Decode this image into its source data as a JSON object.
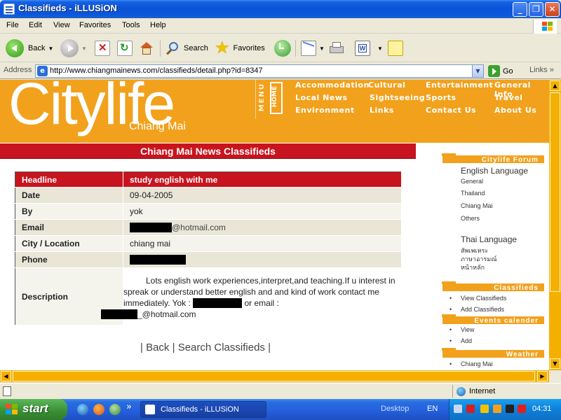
{
  "window": {
    "title": "Classifieds - iLLUSiON",
    "min": "_",
    "max": "❐",
    "close": "✕"
  },
  "menu": [
    "File",
    "Edit",
    "View",
    "Favorites",
    "Tools",
    "Help"
  ],
  "toolbar": {
    "back": "Back",
    "search": "Search",
    "favorites": "Favorites"
  },
  "address": {
    "label": "Address",
    "url": "http://www.chiangmainews.com/classifieds/detail.php?id=8347",
    "go": "Go",
    "links": "Links",
    "more": "»"
  },
  "site": {
    "logo": "Citylife",
    "sublogo": "Chiang Mai",
    "menu_vertical": "MENU",
    "home": "HOME",
    "nav": [
      {
        "label": "Accommodation"
      },
      {
        "label": "Cultural"
      },
      {
        "label": "Entertainment"
      },
      {
        "label": "General Info"
      },
      {
        "label": "Local News"
      },
      {
        "label": "Sightseeing"
      },
      {
        "label": "Travel"
      },
      {
        "label": "Environment"
      },
      {
        "label": "Links"
      },
      {
        "label": "Sports"
      },
      {
        "label": "Contact Us"
      },
      {
        "label": "About Us"
      }
    ],
    "banner": "Chiang Mai News Classifieds"
  },
  "detail": {
    "headline_label": "Headline",
    "headline_value": "study english with me",
    "date_label": "Date",
    "date_value": "09-04-2005",
    "by_label": "By",
    "by_value": "yok",
    "email_label": "Email",
    "email_domain": "@hotmail.com",
    "city_label": "City / Location",
    "city_value": "chiang mai",
    "phone_label": "Phone",
    "description_label": "Description",
    "description_line1": "Lots english work experiences,interpret,and teaching.If u interest in spreak or understand better english and and kind of work contact me immediately.  Yok : ",
    "description_line2": " or email : ",
    "description_email_domain": "_@hotmail.com"
  },
  "bottom_links": {
    "sep_left": "|",
    "back": "Back",
    "sep_mid": "|",
    "search": "Search Classifieds",
    "sep_right": "|"
  },
  "sidebar": {
    "forum_head": "Citylife Forum",
    "english_heading": "English Language",
    "english_items": [
      "General",
      "Thailand",
      "Chiang Mai",
      "Others"
    ],
    "thai_heading": "Thai Language",
    "thai_items": [
      "สัพเพเหระ",
      "ภาษาอารมณ์",
      "หน้าหลัก"
    ],
    "classifieds_head": "Classifieds",
    "classifieds_items": [
      "View Classifieds",
      "Add Classifieds"
    ],
    "events_head": "Events calender",
    "events_items": [
      "View",
      "Add"
    ],
    "weather_head": "Weather",
    "weather_items": [
      "Chiang Mai"
    ]
  },
  "status": {
    "zone": "Internet"
  },
  "taskbar": {
    "start": "start",
    "more": "»",
    "task_title": "Classifieds - iLLUSiON",
    "desktop": "Desktop",
    "lang": "EN",
    "clock": "04:31"
  },
  "colors": {
    "citylife_orange": "#f2a11c",
    "banner_red": "#c8141e",
    "xp_blue": "#0a53d6"
  }
}
